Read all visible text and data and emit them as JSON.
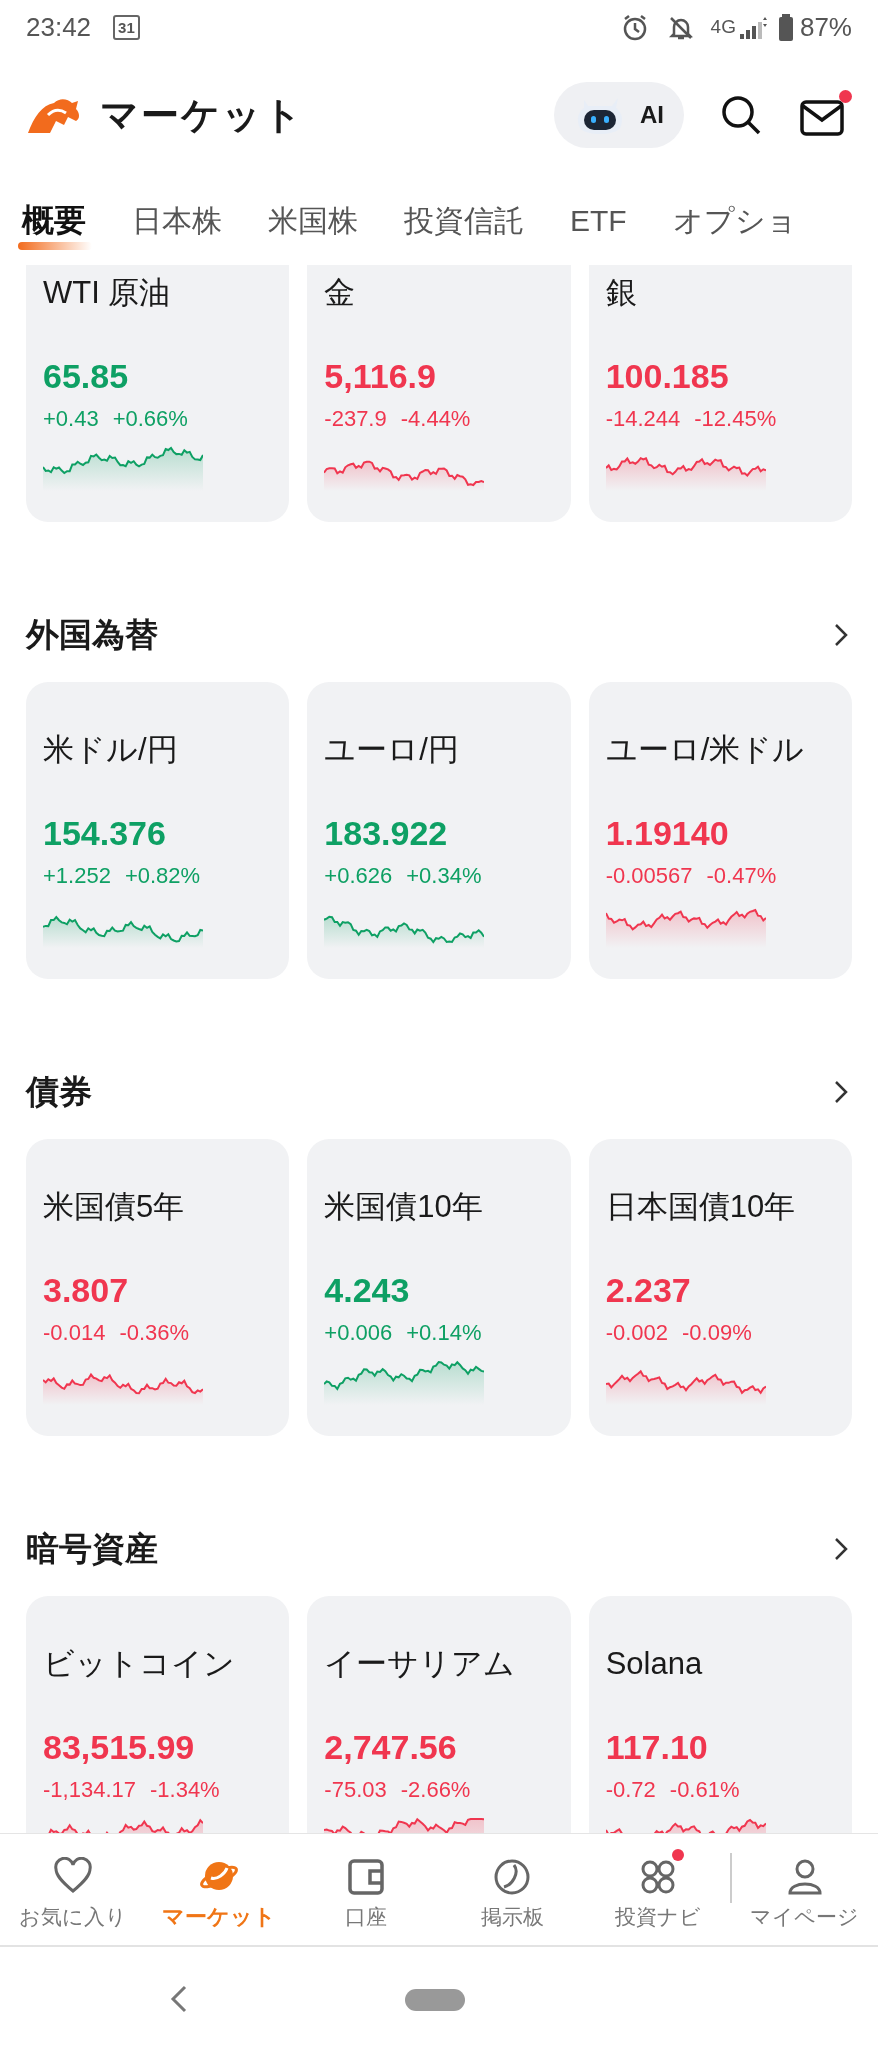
{
  "status_bar": {
    "time": "23:42",
    "calendar_day": "31",
    "network": "4G",
    "battery": "87%"
  },
  "header": {
    "title": "マーケット",
    "ai_label": "AI",
    "mail_dot": true
  },
  "tabs": [
    {
      "label": "概要",
      "selected": true
    },
    {
      "label": "日本株",
      "selected": false
    },
    {
      "label": "米国株",
      "selected": false
    },
    {
      "label": "投資信託",
      "selected": false
    },
    {
      "label": "ETF",
      "selected": false
    },
    {
      "label": "オプショ",
      "selected": false
    }
  ],
  "top_row": [
    {
      "name": "WTI 原油",
      "price": "65.85",
      "change": "+0.43",
      "percent": "+0.66%",
      "kind": "up"
    },
    {
      "name": "金",
      "price": "5,116.9",
      "change": "-237.9",
      "percent": "-4.44%",
      "kind": "down"
    },
    {
      "name": "銀",
      "price": "100.185",
      "change": "-14.244",
      "percent": "-12.45%",
      "kind": "down"
    }
  ],
  "sections": [
    {
      "title": "外国為替",
      "items": [
        {
          "name": "米ドル/円",
          "price": "154.376",
          "change": "+1.252",
          "percent": "+0.82%",
          "kind": "up"
        },
        {
          "name": "ユーロ/円",
          "price": "183.922",
          "change": "+0.626",
          "percent": "+0.34%",
          "kind": "up"
        },
        {
          "name": "ユーロ/米ドル",
          "price": "1.19140",
          "change": "-0.00567",
          "percent": "-0.47%",
          "kind": "down"
        }
      ]
    },
    {
      "title": "債券",
      "items": [
        {
          "name": "米国債5年",
          "price": "3.807",
          "change": "-0.014",
          "percent": "-0.36%",
          "kind": "down"
        },
        {
          "name": "米国債10年",
          "price": "4.243",
          "change": "+0.006",
          "percent": "+0.14%",
          "kind": "up"
        },
        {
          "name": "日本国債10年",
          "price": "2.237",
          "change": "-0.002",
          "percent": "-0.09%",
          "kind": "down"
        }
      ]
    },
    {
      "title": "暗号資産",
      "items": [
        {
          "name": "ビットコイン",
          "price": "83,515.99",
          "change": "-1,134.17",
          "percent": "-1.34%",
          "kind": "down"
        },
        {
          "name": "イーサリアム",
          "price": "2,747.56",
          "change": "-75.03",
          "percent": "-2.66%",
          "kind": "down"
        },
        {
          "name": "Solana",
          "price": "117.10",
          "change": "-0.72",
          "percent": "-0.61%",
          "kind": "down"
        }
      ]
    }
  ],
  "bottom_nav": [
    {
      "label": "お気に入り",
      "selected": false,
      "dot": false
    },
    {
      "label": "マーケット",
      "selected": true,
      "dot": false
    },
    {
      "label": "口座",
      "selected": false,
      "dot": false
    },
    {
      "label": "掲示板",
      "selected": false,
      "dot": false
    },
    {
      "label": "投資ナビ",
      "selected": false,
      "dot": true
    },
    {
      "label": "マイページ",
      "selected": false,
      "dot": false
    }
  ]
}
